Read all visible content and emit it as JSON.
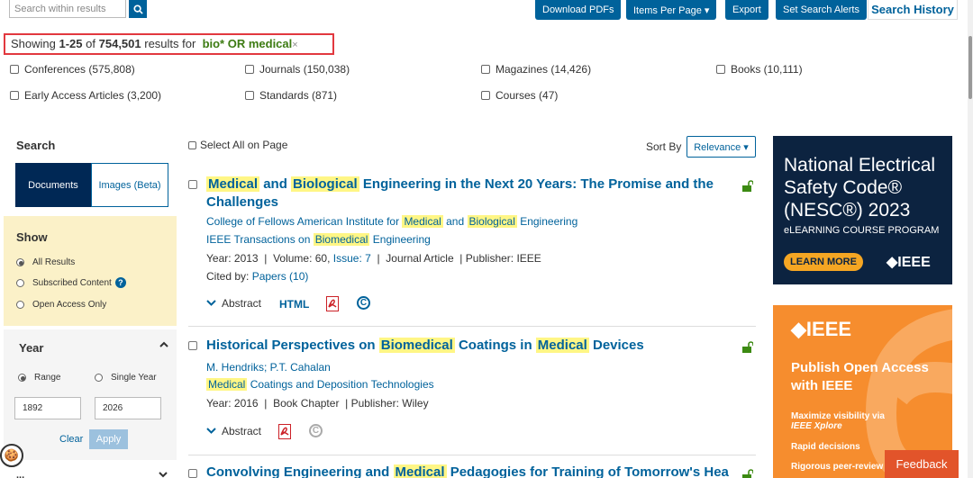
{
  "topbar": {
    "search_placeholder": "Search within results",
    "download_pdfs": "Download PDFs",
    "items_per_page": "Items Per Page ▾",
    "export": "Export",
    "set_search_alerts": "Set Search Alerts",
    "search_history": "Search History"
  },
  "summary": {
    "showing": "Showing",
    "range": "1-25",
    "of": "of",
    "total": "754,501",
    "results_for": "results for",
    "query": "bio* OR medical",
    "remove": "×"
  },
  "content_types": [
    "Conferences (575,808)",
    "Journals (150,038)",
    "Magazines (14,426)",
    "Books (10,111)",
    "Early Access Articles (3,200)",
    "Standards (871)",
    "Courses (47)"
  ],
  "sidebar": {
    "search_label": "Search",
    "tab_documents": "Documents",
    "tab_images": "Images (Beta)",
    "show_label": "Show",
    "show_options": [
      "All Results",
      "Subscribed Content",
      "Open Access Only"
    ],
    "year_label": "Year",
    "range": "Range",
    "single_year": "Single Year",
    "year_from": "1892",
    "year_to": "2026",
    "clear": "Clear",
    "apply": "Apply",
    "next_section_label": "..."
  },
  "results_header": {
    "select_all": "Select All on Page",
    "sort_by": "Sort By",
    "sort_value": "Relevance ▾"
  },
  "results": [
    {
      "title_parts": [
        "Medical",
        " and ",
        "Biological",
        " Engineering in the Next 20 Years: The Promise and the Challenges"
      ],
      "authors_parts": [
        "College of Fellows American Institute for ",
        "Medical",
        " and ",
        "Biological",
        " Engineering"
      ],
      "publication_parts": [
        "IEEE Transactions on ",
        "Biomedical",
        " Engineering"
      ],
      "year": "Year: 2013",
      "volume": "Volume: 60,",
      "issue": "Issue: 7",
      "type": "Journal Article",
      "publisher": "Publisher:  IEEE",
      "cited_by": "Cited by:",
      "papers": "Papers (10)",
      "abstract": "Abstract",
      "html": "HTML"
    },
    {
      "title_parts": [
        "Historical Perspectives on ",
        "Biomedical",
        " Coatings in ",
        "Medical",
        " Devices"
      ],
      "authors": "M. Hendriks; P.T. Cahalan",
      "publication_parts": [
        "Medical",
        " Coatings and Deposition Technologies"
      ],
      "year": "Year: 2016",
      "type": "Book Chapter",
      "publisher": "Publisher:  Wiley",
      "abstract": "Abstract"
    },
    {
      "title_parts": [
        "Convolving Engineering and ",
        "Medical",
        " Pedagogies for Training of Tomorrow's Health"
      ]
    }
  ],
  "ads": {
    "nesc_line1": "National Electrical",
    "nesc_line2": "Safety Code®",
    "nesc_line3": "(NESC®) 2023",
    "nesc_sub": "eLEARNING COURSE PROGRAM",
    "nesc_cta": "LEARN MORE",
    "nesc_logo": "◆IEEE",
    "oa_logo": "◆IEEE",
    "oa_headline1": "Publish Open Access",
    "oa_headline2": "with IEEE",
    "oa_line1": "Maximize visibility via",
    "oa_line2": "IEEE Xplore",
    "oa_line3": "Rapid decisions",
    "oa_line4": "Rigorous peer-review"
  },
  "feedback": "Feedback",
  "colors": {
    "brand": "#00629b",
    "navy": "#002855",
    "highlight": "#fff685",
    "query_green": "#3c7b12",
    "alert_red": "#e2383f",
    "feedback": "#e2542a"
  }
}
